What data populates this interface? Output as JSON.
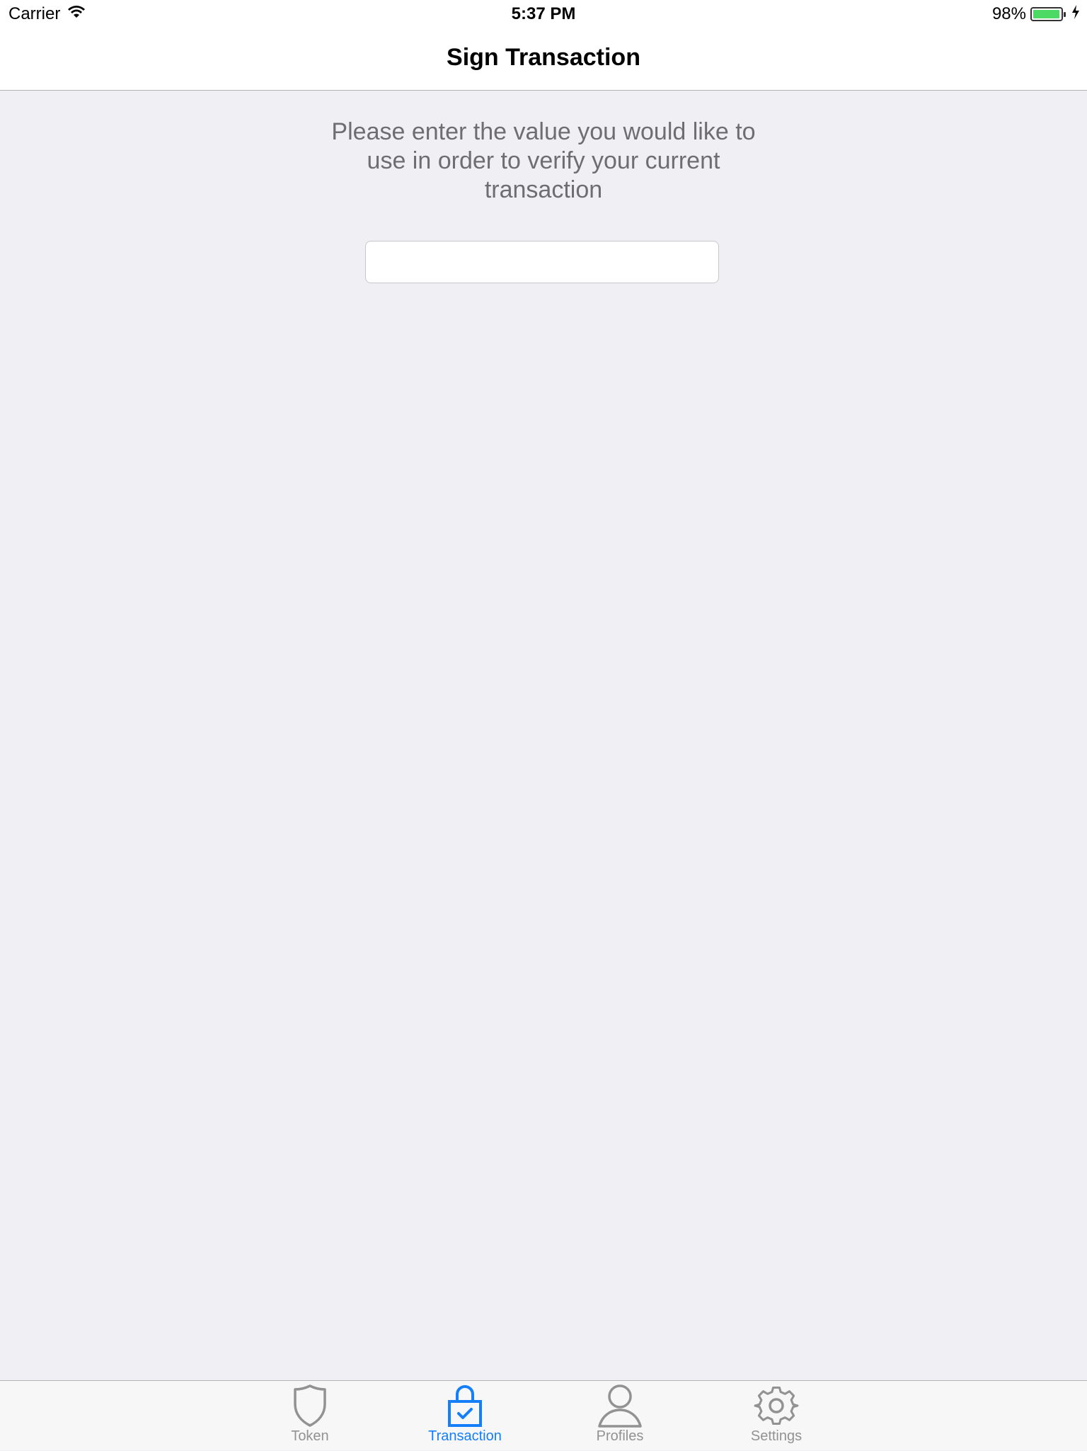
{
  "status_bar": {
    "carrier": "Carrier",
    "time": "5:37 PM",
    "battery_percent": "98%",
    "battery_level": 0.98,
    "wifi_icon": "wifi-icon",
    "charging_icon": "charging-bolt-icon"
  },
  "nav": {
    "title": "Sign Transaction"
  },
  "main": {
    "instruction": "Please enter the value you would like to use in order to verify your current transaction",
    "input_value": "",
    "input_placeholder": ""
  },
  "tab_bar": {
    "active_color": "#157efb",
    "inactive_color": "#929292",
    "tabs": [
      {
        "label": "Token",
        "icon": "shield-icon",
        "active": false
      },
      {
        "label": "Transaction",
        "icon": "lock-check-icon",
        "active": true
      },
      {
        "label": "Profiles",
        "icon": "person-icon",
        "active": false
      },
      {
        "label": "Settings",
        "icon": "gear-icon",
        "active": false
      }
    ]
  }
}
